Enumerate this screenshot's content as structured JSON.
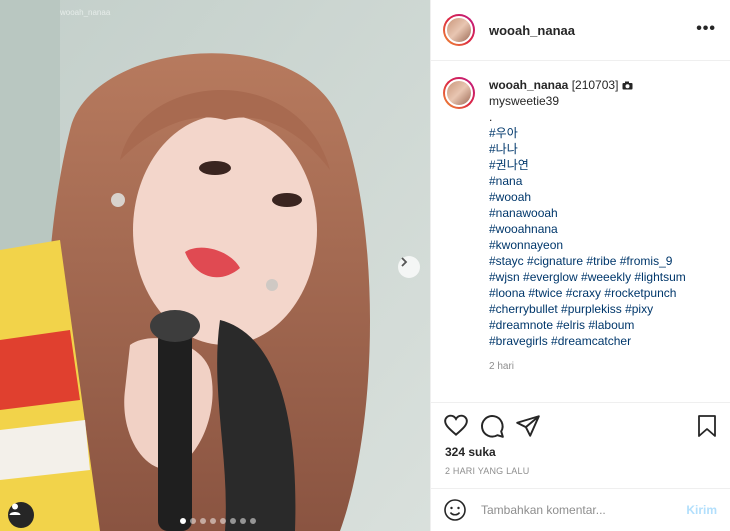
{
  "photo": {
    "watermark": "wooah_nanaa",
    "carousel_count": 8,
    "carousel_active": 0
  },
  "header": {
    "username": "wooah_nanaa",
    "more_icon": "more-horizontal-icon"
  },
  "caption": {
    "username": "wooah_nanaa",
    "date_tag": "[210703]",
    "camera_icon": "camera-icon",
    "credit": "mysweetie39",
    "dot": ".",
    "lines": [
      "#우아",
      "#나나",
      "#권나연",
      "#nana",
      "#wooah",
      "#nanawooah",
      "#wooahnana",
      "#kwonnayeon",
      "#stayc #cignature #tribe #fromis_9",
      "#wjsn #everglow #weeekly #lightsum",
      "#loona #twice #craxy #rocketpunch",
      "#cherrybullet #purplekiss #pixy",
      "#dreamnote #elris #laboum",
      "#bravegirls #dreamcatcher"
    ],
    "time": "2 hari"
  },
  "actions": {
    "likes": "324 suka",
    "date": "2 HARI YANG LALU"
  },
  "comment": {
    "placeholder": "Tambahkan komentar...",
    "post_label": "Kirim"
  },
  "colors": {
    "link": "#00376b",
    "muted": "#8e8e8e",
    "post_disabled": "#b2dffc"
  }
}
